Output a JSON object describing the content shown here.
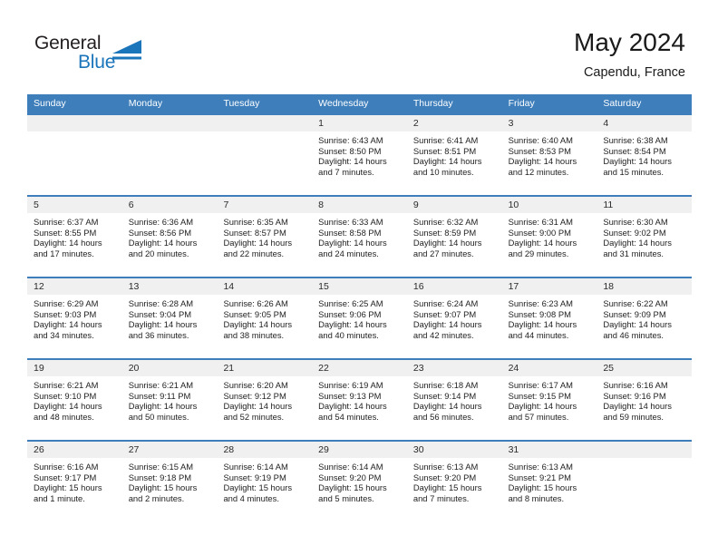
{
  "brand": {
    "name_top": "General",
    "name_bottom": "Blue",
    "color_dark": "#231f20",
    "color_blue": "#1b75bb",
    "mark": "triangle-logo-icon"
  },
  "header": {
    "title": "May 2024",
    "subtitle": "Capendu, France"
  },
  "theme": {
    "header_blue": "#3D7EBB",
    "date_band_gray": "#F0F0F0",
    "cell_white": "#FFFFFF",
    "text": "#222222"
  },
  "weekdays": [
    "Sunday",
    "Monday",
    "Tuesday",
    "Wednesday",
    "Thursday",
    "Friday",
    "Saturday"
  ],
  "weeks": [
    [
      {
        "day": "",
        "empty": true
      },
      {
        "day": "",
        "empty": true
      },
      {
        "day": "",
        "empty": true
      },
      {
        "day": "1",
        "sunrise": "Sunrise: 6:43 AM",
        "sunset": "Sunset: 8:50 PM",
        "daylight": "Daylight: 14 hours and 7 minutes."
      },
      {
        "day": "2",
        "sunrise": "Sunrise: 6:41 AM",
        "sunset": "Sunset: 8:51 PM",
        "daylight": "Daylight: 14 hours and 10 minutes."
      },
      {
        "day": "3",
        "sunrise": "Sunrise: 6:40 AM",
        "sunset": "Sunset: 8:53 PM",
        "daylight": "Daylight: 14 hours and 12 minutes."
      },
      {
        "day": "4",
        "sunrise": "Sunrise: 6:38 AM",
        "sunset": "Sunset: 8:54 PM",
        "daylight": "Daylight: 14 hours and 15 minutes."
      }
    ],
    [
      {
        "day": "5",
        "sunrise": "Sunrise: 6:37 AM",
        "sunset": "Sunset: 8:55 PM",
        "daylight": "Daylight: 14 hours and 17 minutes."
      },
      {
        "day": "6",
        "sunrise": "Sunrise: 6:36 AM",
        "sunset": "Sunset: 8:56 PM",
        "daylight": "Daylight: 14 hours and 20 minutes."
      },
      {
        "day": "7",
        "sunrise": "Sunrise: 6:35 AM",
        "sunset": "Sunset: 8:57 PM",
        "daylight": "Daylight: 14 hours and 22 minutes."
      },
      {
        "day": "8",
        "sunrise": "Sunrise: 6:33 AM",
        "sunset": "Sunset: 8:58 PM",
        "daylight": "Daylight: 14 hours and 24 minutes."
      },
      {
        "day": "9",
        "sunrise": "Sunrise: 6:32 AM",
        "sunset": "Sunset: 8:59 PM",
        "daylight": "Daylight: 14 hours and 27 minutes."
      },
      {
        "day": "10",
        "sunrise": "Sunrise: 6:31 AM",
        "sunset": "Sunset: 9:00 PM",
        "daylight": "Daylight: 14 hours and 29 minutes."
      },
      {
        "day": "11",
        "sunrise": "Sunrise: 6:30 AM",
        "sunset": "Sunset: 9:02 PM",
        "daylight": "Daylight: 14 hours and 31 minutes."
      }
    ],
    [
      {
        "day": "12",
        "sunrise": "Sunrise: 6:29 AM",
        "sunset": "Sunset: 9:03 PM",
        "daylight": "Daylight: 14 hours and 34 minutes."
      },
      {
        "day": "13",
        "sunrise": "Sunrise: 6:28 AM",
        "sunset": "Sunset: 9:04 PM",
        "daylight": "Daylight: 14 hours and 36 minutes."
      },
      {
        "day": "14",
        "sunrise": "Sunrise: 6:26 AM",
        "sunset": "Sunset: 9:05 PM",
        "daylight": "Daylight: 14 hours and 38 minutes."
      },
      {
        "day": "15",
        "sunrise": "Sunrise: 6:25 AM",
        "sunset": "Sunset: 9:06 PM",
        "daylight": "Daylight: 14 hours and 40 minutes."
      },
      {
        "day": "16",
        "sunrise": "Sunrise: 6:24 AM",
        "sunset": "Sunset: 9:07 PM",
        "daylight": "Daylight: 14 hours and 42 minutes."
      },
      {
        "day": "17",
        "sunrise": "Sunrise: 6:23 AM",
        "sunset": "Sunset: 9:08 PM",
        "daylight": "Daylight: 14 hours and 44 minutes."
      },
      {
        "day": "18",
        "sunrise": "Sunrise: 6:22 AM",
        "sunset": "Sunset: 9:09 PM",
        "daylight": "Daylight: 14 hours and 46 minutes."
      }
    ],
    [
      {
        "day": "19",
        "sunrise": "Sunrise: 6:21 AM",
        "sunset": "Sunset: 9:10 PM",
        "daylight": "Daylight: 14 hours and 48 minutes."
      },
      {
        "day": "20",
        "sunrise": "Sunrise: 6:21 AM",
        "sunset": "Sunset: 9:11 PM",
        "daylight": "Daylight: 14 hours and 50 minutes."
      },
      {
        "day": "21",
        "sunrise": "Sunrise: 6:20 AM",
        "sunset": "Sunset: 9:12 PM",
        "daylight": "Daylight: 14 hours and 52 minutes."
      },
      {
        "day": "22",
        "sunrise": "Sunrise: 6:19 AM",
        "sunset": "Sunset: 9:13 PM",
        "daylight": "Daylight: 14 hours and 54 minutes."
      },
      {
        "day": "23",
        "sunrise": "Sunrise: 6:18 AM",
        "sunset": "Sunset: 9:14 PM",
        "daylight": "Daylight: 14 hours and 56 minutes."
      },
      {
        "day": "24",
        "sunrise": "Sunrise: 6:17 AM",
        "sunset": "Sunset: 9:15 PM",
        "daylight": "Daylight: 14 hours and 57 minutes."
      },
      {
        "day": "25",
        "sunrise": "Sunrise: 6:16 AM",
        "sunset": "Sunset: 9:16 PM",
        "daylight": "Daylight: 14 hours and 59 minutes."
      }
    ],
    [
      {
        "day": "26",
        "sunrise": "Sunrise: 6:16 AM",
        "sunset": "Sunset: 9:17 PM",
        "daylight": "Daylight: 15 hours and 1 minute."
      },
      {
        "day": "27",
        "sunrise": "Sunrise: 6:15 AM",
        "sunset": "Sunset: 9:18 PM",
        "daylight": "Daylight: 15 hours and 2 minutes."
      },
      {
        "day": "28",
        "sunrise": "Sunrise: 6:14 AM",
        "sunset": "Sunset: 9:19 PM",
        "daylight": "Daylight: 15 hours and 4 minutes."
      },
      {
        "day": "29",
        "sunrise": "Sunrise: 6:14 AM",
        "sunset": "Sunset: 9:20 PM",
        "daylight": "Daylight: 15 hours and 5 minutes."
      },
      {
        "day": "30",
        "sunrise": "Sunrise: 6:13 AM",
        "sunset": "Sunset: 9:20 PM",
        "daylight": "Daylight: 15 hours and 7 minutes."
      },
      {
        "day": "31",
        "sunrise": "Sunrise: 6:13 AM",
        "sunset": "Sunset: 9:21 PM",
        "daylight": "Daylight: 15 hours and 8 minutes."
      },
      {
        "day": "",
        "empty": true
      }
    ]
  ]
}
